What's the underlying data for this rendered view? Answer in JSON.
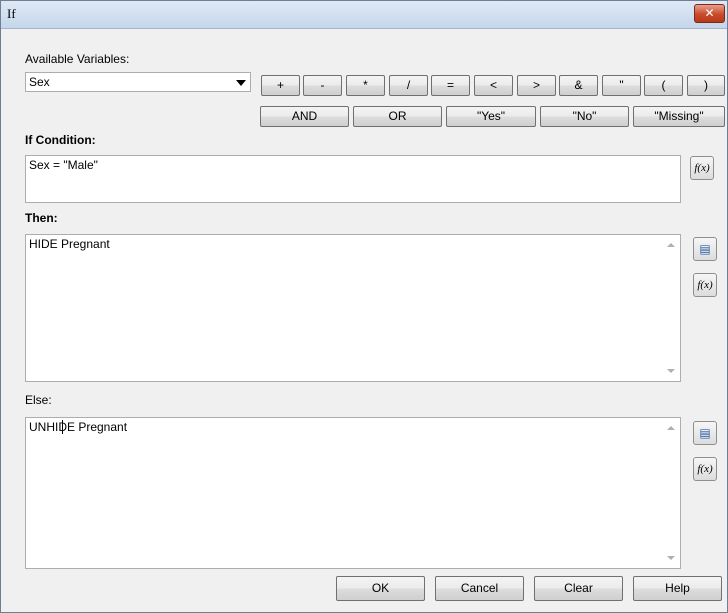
{
  "window": {
    "title": "If",
    "close_glyph": "✕"
  },
  "available_variables": {
    "label": "Available Variables:",
    "selected": "Sex"
  },
  "operators": [
    "+",
    "-",
    "*",
    "/",
    "=",
    "<",
    ">",
    "&",
    "\"",
    "(",
    ")"
  ],
  "logic_buttons": [
    "AND",
    "OR",
    "\"Yes\"",
    "\"No\"",
    "\"Missing\""
  ],
  "if_condition": {
    "label": "If Condition:",
    "value": "Sex = \"Male\""
  },
  "then": {
    "label": "Then:",
    "value": "HIDE Pregnant"
  },
  "else": {
    "label": "Else:",
    "value": "UNHIDE Pregnant"
  },
  "side_buttons": {
    "function": "f(x)",
    "document_icon": "document-icon"
  },
  "footer": {
    "ok": "OK",
    "cancel": "Cancel",
    "clear": "Clear",
    "help": "Help"
  }
}
